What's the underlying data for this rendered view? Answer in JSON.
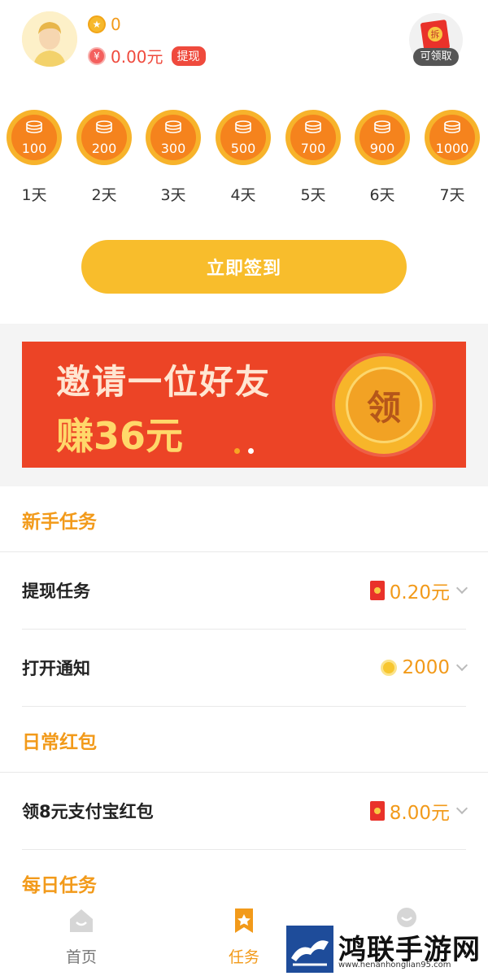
{
  "header": {
    "coin_glyph": "★",
    "coins": "0",
    "yuan_glyph": "¥",
    "balance": "0.00元",
    "withdraw_label": "提现",
    "redpack_glyph": "拆",
    "redpack_label": "可领取"
  },
  "signin": {
    "days": [
      {
        "amount": "100",
        "label": "1天"
      },
      {
        "amount": "200",
        "label": "2天"
      },
      {
        "amount": "300",
        "label": "3天"
      },
      {
        "amount": "500",
        "label": "4天"
      },
      {
        "amount": "700",
        "label": "5天"
      },
      {
        "amount": "900",
        "label": "6天"
      },
      {
        "amount": "1000",
        "label": "7天"
      }
    ],
    "button_label": "立即签到"
  },
  "banner": {
    "line1": "邀请一位好友",
    "line2": "赚36元",
    "claim_label": "领",
    "active_dot": 0,
    "dot_count": 2
  },
  "sections": {
    "newbie_title": "新手任务",
    "daily_redpack_title": "日常红包",
    "daily_task_title": "每日任务"
  },
  "tasks": [
    {
      "name": "提现任务",
      "reward": "0.20元",
      "icon": "red-packet-icon"
    },
    {
      "name": "打开通知",
      "reward": "2000",
      "icon": "gold-coin-icon"
    },
    {
      "name": "领8元支付宝红包",
      "reward": "8.00元",
      "icon": "red-packet-icon"
    }
  ],
  "nav": {
    "home_label": "首页",
    "task_label": "任务",
    "home_icon": "home-icon",
    "task_icon": "task-bookmark-icon",
    "me_icon": "profile-icon"
  },
  "watermark": {
    "text": "鸿联手游网",
    "url": "www.henanhonglian95.com"
  },
  "colors": {
    "accent": "#f29a1a",
    "button": "#f8bd2c",
    "red": "#ef4a3d",
    "banner": "#ec4426"
  }
}
